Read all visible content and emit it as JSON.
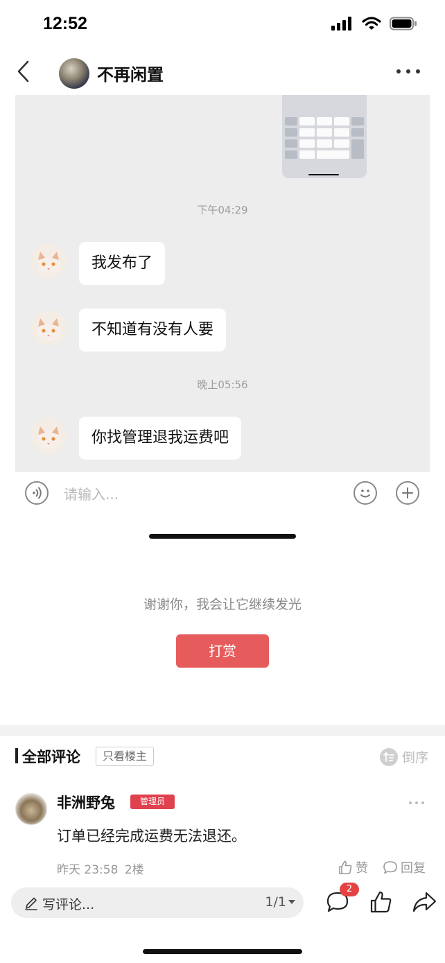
{
  "status_bar": {
    "time": "12:52"
  },
  "nav": {
    "title": "不再闲置"
  },
  "chat": {
    "messages": [
      {
        "time": "下午04:29",
        "text": "我发布了"
      },
      {
        "text": "不知道有没有人要"
      },
      {
        "time": "晚上05:56",
        "text": "你找管理退我运费吧"
      }
    ],
    "input_placeholder": "请输入..."
  },
  "reward": {
    "text": "谢谢你，我会让它继续发光",
    "button": "打赏"
  },
  "comments": {
    "title": "全部评论",
    "filter": "只看楼主",
    "sort": "倒序",
    "items": [
      {
        "author": "非洲野兔",
        "badge": "管理员",
        "text": "订单已经完成运费无法退还。",
        "time": "昨天 23:58",
        "floor": "2楼",
        "like_label": "赞",
        "reply_label": "回复"
      }
    ]
  },
  "bottom_bar": {
    "write_label": "写评论...",
    "page": "1/1",
    "comment_count": "2"
  }
}
